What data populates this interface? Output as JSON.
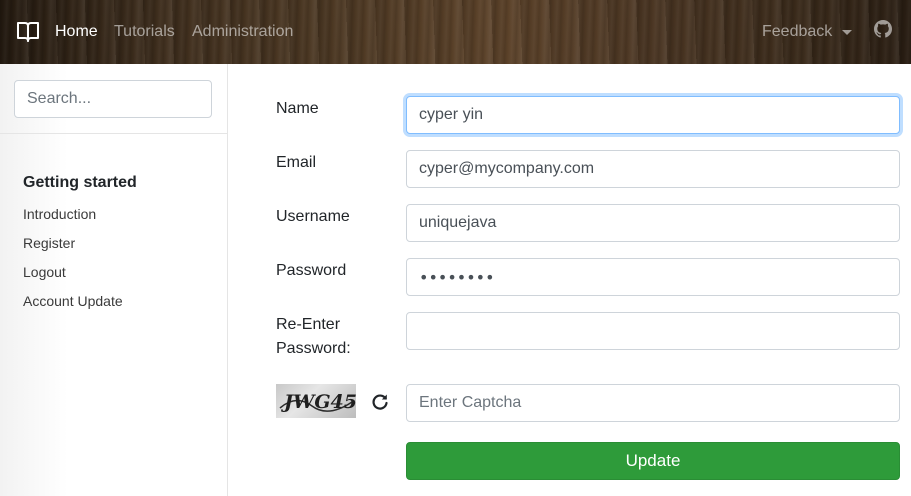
{
  "navbar": {
    "brand_icon": "book-open-icon",
    "links": [
      {
        "label": "Home",
        "active": true
      },
      {
        "label": "Tutorials",
        "active": false
      },
      {
        "label": "Administration",
        "active": false
      }
    ],
    "feedback_label": "Feedback",
    "github_icon": "github-icon"
  },
  "sidebar": {
    "search_placeholder": "Search...",
    "section_title": "Getting started",
    "items": [
      {
        "label": "Introduction"
      },
      {
        "label": "Register"
      },
      {
        "label": "Logout"
      },
      {
        "label": "Account Update"
      }
    ]
  },
  "form": {
    "name": {
      "label": "Name",
      "value": "cyper yin"
    },
    "email": {
      "label": "Email",
      "value": "cyper@mycompany.com"
    },
    "username": {
      "label": "Username",
      "value": "uniquejava"
    },
    "password": {
      "label": "Password",
      "value": "••••••••"
    },
    "reenter_password": {
      "label_line1": "Re-Enter",
      "label_line2": "Password:",
      "value": ""
    },
    "captcha": {
      "image_text": "JWG45",
      "placeholder": "Enter Captcha",
      "value": ""
    },
    "update_label": "Update"
  },
  "colors": {
    "accent": "#2e9b3a",
    "focus": "#80bdff"
  }
}
